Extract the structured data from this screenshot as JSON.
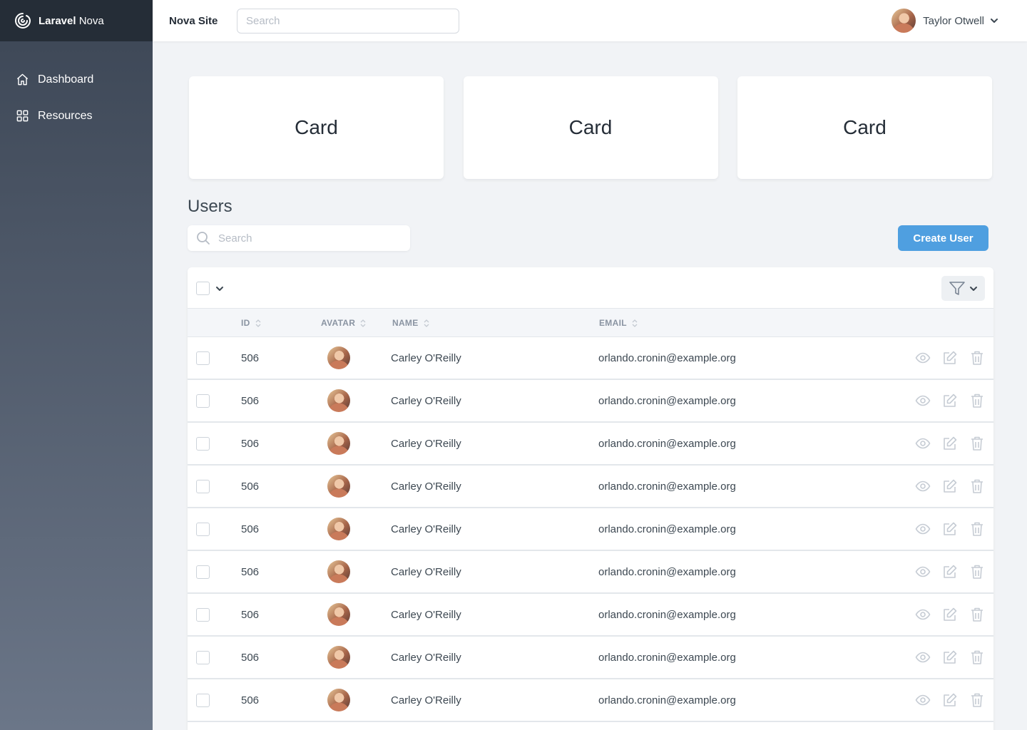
{
  "brand": {
    "bold": "Laravel",
    "light": " Nova"
  },
  "sidebar": {
    "items": [
      {
        "label": "Dashboard",
        "icon": "home-icon"
      },
      {
        "label": "Resources",
        "icon": "grid-icon"
      }
    ]
  },
  "header": {
    "site_name": "Nova Site",
    "search_placeholder": "Search",
    "user_name": "Taylor Otwell"
  },
  "cards": [
    "Card",
    "Card",
    "Card"
  ],
  "resource": {
    "title": "Users",
    "search_placeholder": "Search",
    "create_label": "Create User"
  },
  "table": {
    "columns": [
      "ID",
      "AVATAR",
      "NAME",
      "EMAIL"
    ],
    "rows": [
      {
        "id": "506",
        "name": "Carley O'Reilly",
        "email": "orlando.cronin@example.org"
      },
      {
        "id": "506",
        "name": "Carley O'Reilly",
        "email": "orlando.cronin@example.org"
      },
      {
        "id": "506",
        "name": "Carley O'Reilly",
        "email": "orlando.cronin@example.org"
      },
      {
        "id": "506",
        "name": "Carley O'Reilly",
        "email": "orlando.cronin@example.org"
      },
      {
        "id": "506",
        "name": "Carley O'Reilly",
        "email": "orlando.cronin@example.org"
      },
      {
        "id": "506",
        "name": "Carley O'Reilly",
        "email": "orlando.cronin@example.org"
      },
      {
        "id": "506",
        "name": "Carley O'Reilly",
        "email": "orlando.cronin@example.org"
      },
      {
        "id": "506",
        "name": "Carley O'Reilly",
        "email": "orlando.cronin@example.org"
      },
      {
        "id": "506",
        "name": "Carley O'Reilly",
        "email": "orlando.cronin@example.org"
      }
    ]
  },
  "colors": {
    "accent": "#4f9fe0",
    "sidebar_top": "#3c4655",
    "brand_bar": "#252d37"
  }
}
